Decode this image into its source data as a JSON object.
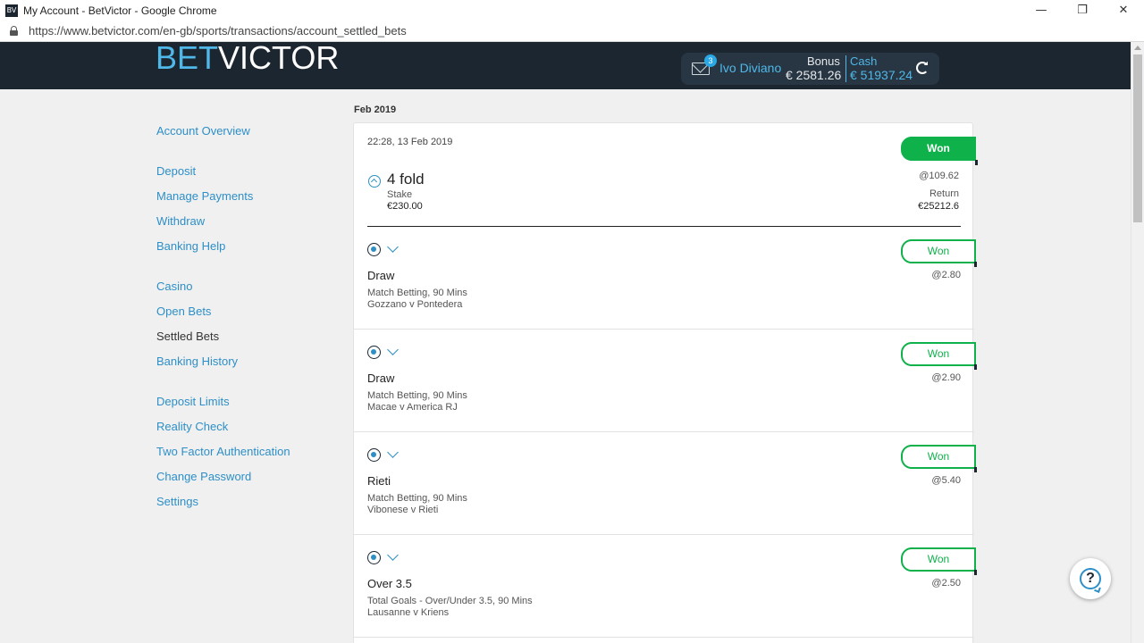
{
  "window": {
    "favicon_text": "BV",
    "title": "My Account - BetVictor - Google Chrome",
    "minimize": "—",
    "restore": "❐",
    "close": "✕"
  },
  "addressbar": {
    "url": "https://www.betvictor.com/en-gb/sports/transactions/account_settled_bets"
  },
  "header": {
    "logo_bet": "BET",
    "logo_victor": "VICTOR",
    "mail_badge": "3",
    "account_name": "Ivo Diviano",
    "bonus_label": "Bonus",
    "bonus_value": "€ 2581.26",
    "cash_label": "Cash",
    "cash_value": "€ 51937.24"
  },
  "sidebar": {
    "groups": [
      [
        {
          "label": "Account Overview",
          "active": false
        }
      ],
      [
        {
          "label": "Deposit"
        },
        {
          "label": "Manage Payments"
        },
        {
          "label": "Withdraw"
        },
        {
          "label": "Banking Help"
        }
      ],
      [
        {
          "label": "Casino"
        },
        {
          "label": "Open Bets"
        },
        {
          "label": "Settled Bets",
          "active": true
        },
        {
          "label": "Banking History"
        }
      ],
      [
        {
          "label": "Deposit Limits"
        },
        {
          "label": "Reality Check"
        },
        {
          "label": "Two Factor Authentication"
        },
        {
          "label": "Change Password"
        },
        {
          "label": "Settings"
        }
      ]
    ]
  },
  "main": {
    "month": "Feb 2019",
    "bet": {
      "date": "22:28, 13 Feb 2019",
      "status": "Won",
      "title": "4 fold",
      "stake_label": "Stake",
      "stake_value": "€230.00",
      "odds": "@109.62",
      "return_label": "Return",
      "return_value": "€25212.6"
    },
    "legs": [
      {
        "status": "Won",
        "selection": "Draw",
        "market": "Match Betting, 90 Mins",
        "event": "Gozzano v Pontedera",
        "odds": "@2.80"
      },
      {
        "status": "Won",
        "selection": "Draw",
        "market": "Match Betting, 90 Mins",
        "event": "Macae v America RJ",
        "odds": "@2.90"
      },
      {
        "status": "Won",
        "selection": "Rieti",
        "market": "Match Betting, 90 Mins",
        "event": "Vibonese v Rieti",
        "odds": "@5.40"
      },
      {
        "status": "Won",
        "selection": "Over 3.5",
        "market": "Total Goals - Over/Under 3.5, 90 Mins",
        "event": "Lausanne v Kriens",
        "odds": "@2.50"
      }
    ]
  },
  "help": {
    "label": "?"
  },
  "colors": {
    "accent": "#2d8fc7",
    "won": "#0fb14a",
    "header": "#1c2631"
  }
}
